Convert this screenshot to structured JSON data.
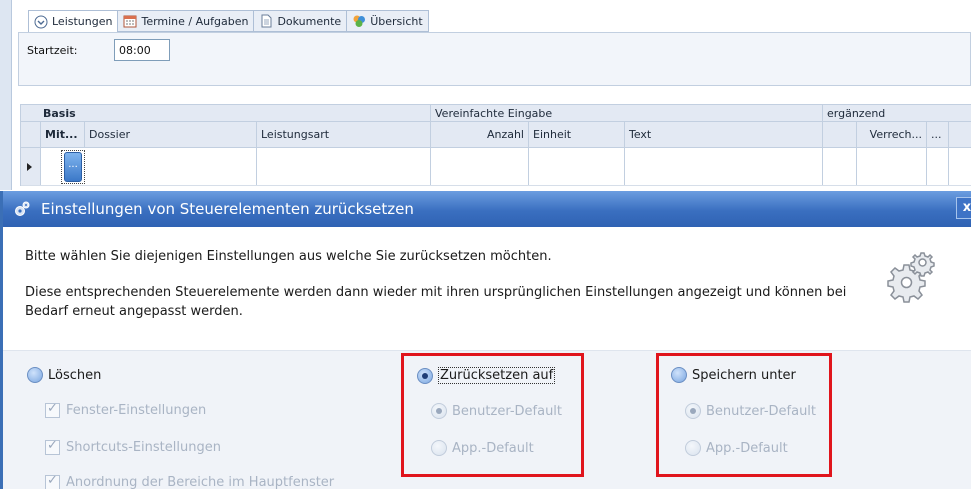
{
  "tabs": [
    {
      "label": "Leistungen",
      "icon": "chevron-circle-icon",
      "active": true
    },
    {
      "label": "Termine / Aufgaben",
      "icon": "calendar-icon",
      "active": false
    },
    {
      "label": "Dokumente",
      "icon": "document-icon",
      "active": false
    },
    {
      "label": "Übersicht",
      "icon": "overview-icon",
      "active": false
    }
  ],
  "form": {
    "start_label": "Startzeit:",
    "start_value": "08:00"
  },
  "grid": {
    "group_headers": [
      "Basis",
      "Vereinfachte Eingabe",
      "ergänzend"
    ],
    "columns": [
      "Mit...",
      "Dossier",
      "Leistungsart",
      "Anzahl",
      "Einheit",
      "Text",
      "Verrech...",
      "..."
    ],
    "row_button": "..."
  },
  "dialog": {
    "title": "Einstellungen von Steuerelementen zurücksetzen",
    "close": "x",
    "intro": "Bitte wählen Sie diejenigen Einstellungen aus welche Sie zurücksetzen möchten.",
    "description": "Diese entsprechenden Steuerelemente werden dann wieder mit ihren ursprünglichen Einstellungen angezeigt und können bei Bedarf erneut angepasst werden.",
    "options": {
      "delete": {
        "label": "Löschen",
        "checked": false,
        "items": [
          "Fenster-Einstellungen",
          "Shortcuts-Einstellungen",
          "Anordnung der Bereiche im Hauptfenster"
        ]
      },
      "reset": {
        "label": "Zurücksetzen auf",
        "checked": true,
        "items": [
          "Benutzer-Default",
          "App.-Default"
        ]
      },
      "save": {
        "label": "Speichern unter",
        "checked": false,
        "items": [
          "Benutzer-Default",
          "App.-Default"
        ]
      }
    }
  },
  "colors": {
    "titlebar": "#3a6fc0",
    "highlight_box": "#e0141c",
    "disabled_text": "#a9b4c4"
  }
}
